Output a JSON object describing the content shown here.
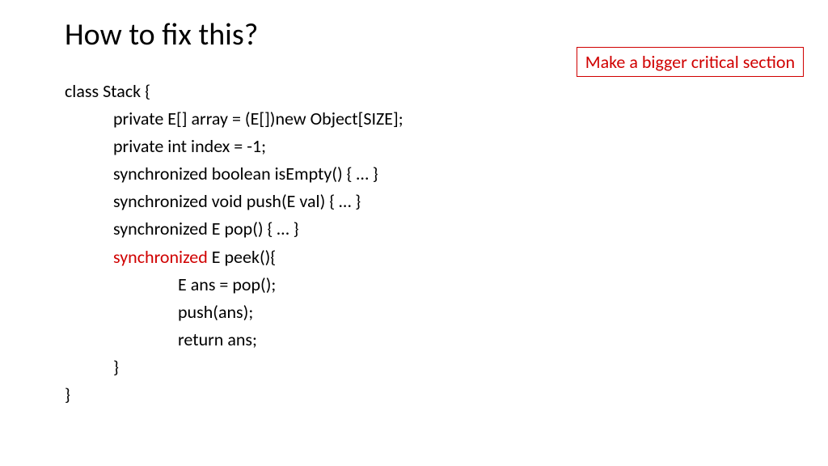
{
  "title": "How to fix this?",
  "callout": "Make a bigger critical section",
  "code": {
    "l0": "class Stack {",
    "l1": "private E[] array = (E[])new Object[SIZE];",
    "l2": "private int index = -1;",
    "l3": "synchronized boolean isEmpty() { … }",
    "l4": "synchronized void push(E val) { … }",
    "l5": "synchronized E pop() { … }",
    "l6a": "synchronized",
    "l6b": " E peek(){",
    "l7": "E ans = pop();",
    "l8": "push(ans);",
    "l9": "return ans;",
    "l10": "}",
    "l11": "}"
  }
}
